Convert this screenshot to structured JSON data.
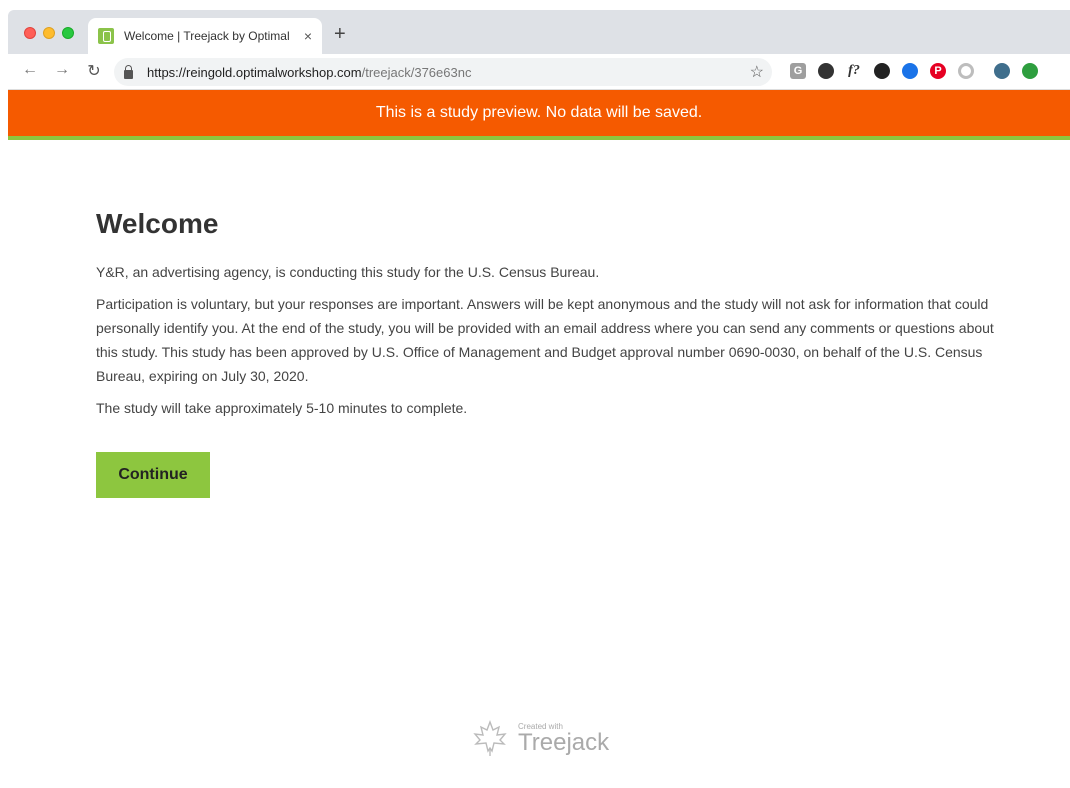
{
  "browser": {
    "tab_title": "Welcome | Treejack by Optimal",
    "tab_close": "×",
    "new_tab": "+",
    "url_host": "https://reingold.optimalworkshop.com",
    "url_path": "/treejack/376e63nc",
    "extensions": [
      {
        "name": "g-icon",
        "label": "G",
        "color": "#9e9e9e"
      },
      {
        "name": "drop-icon",
        "label": "",
        "color": "#333333"
      },
      {
        "name": "fx-icon",
        "label": "f?",
        "color": "#333333"
      },
      {
        "name": "dial-icon",
        "label": "",
        "color": "#222222"
      },
      {
        "name": "chrome-icon",
        "label": "",
        "color": "#1a73e8"
      },
      {
        "name": "pinterest-icon",
        "label": "P",
        "color": "#e60023"
      },
      {
        "name": "circle-icon",
        "label": "",
        "color": "#bdbdbd"
      },
      {
        "name": "avatar-icon",
        "label": "",
        "color": "#3f6e8c"
      },
      {
        "name": "upload-icon",
        "label": "",
        "color": "#2e9e3f"
      }
    ]
  },
  "banner": {
    "text": "This is a study preview. No data will be saved."
  },
  "main": {
    "title": "Welcome",
    "paragraphs": [
      "Y&R, an advertising agency, is conducting this study for the U.S. Census Bureau.",
      "Participation is voluntary, but your responses are important. Answers will be kept anonymous and the study will not ask for information that could personally identify you. At the end of the study, you will be provided with an email address where you can send any comments or questions about this study. This study has been approved by U.S. Office of Management and Budget approval number 0690-0030, on behalf of the U.S. Census Bureau, expiring on July 30, 2020.",
      "The study will take approximately 5-10 minutes to complete."
    ],
    "continue_label": "Continue"
  },
  "footer": {
    "created_with": "Created with",
    "brand": "Treejack"
  },
  "colors": {
    "banner": "#f55a00",
    "accent_green": "#8dc63f"
  }
}
